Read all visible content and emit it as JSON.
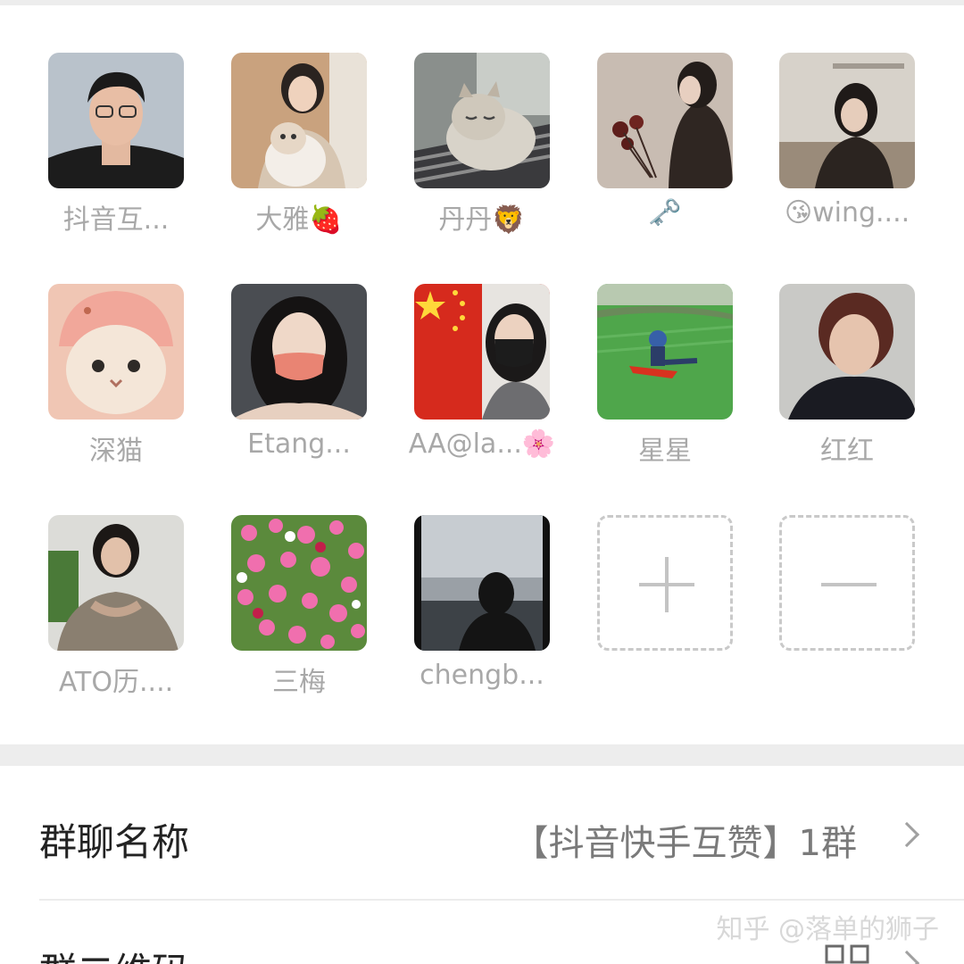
{
  "members": [
    {
      "name": "抖音互..."
    },
    {
      "name": "大雅🍓"
    },
    {
      "name": "丹丹🦁"
    },
    {
      "name": "🗝️"
    },
    {
      "name": "😘wing...."
    },
    {
      "name": "深猫"
    },
    {
      "name": "Etang..."
    },
    {
      "name": "AA@la...🌸"
    },
    {
      "name": "星星"
    },
    {
      "name": "红红"
    },
    {
      "name": "ATO历...."
    },
    {
      "name": "三梅"
    },
    {
      "name": "chengb..."
    }
  ],
  "settings": {
    "group_name_label": "群聊名称",
    "group_name_value": "【抖音快手互赞】1群",
    "qr_label": "群二维码"
  },
  "watermark": "知乎 @落单的狮子",
  "icons": {
    "add": "plus-icon",
    "remove": "minus-icon",
    "chevron": "chevron-right-icon",
    "qr": "qr-code-icon"
  }
}
